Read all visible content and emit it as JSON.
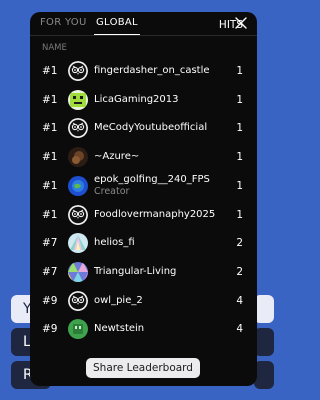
{
  "background_buttons": [
    {
      "label": "Y"
    },
    {
      "label": "L"
    },
    {
      "label": "R"
    }
  ],
  "tabs": {
    "for_you": "FOR YOU",
    "global": "GLOBAL",
    "active": "global"
  },
  "headers": {
    "name": "NAME",
    "hits": "HITS"
  },
  "rows": [
    {
      "rank": "#1",
      "name": "fingerdasher_on_castle",
      "sub": "",
      "hits": "1",
      "avatar": "owl-icon"
    },
    {
      "rank": "#1",
      "name": "LicaGaming2013",
      "sub": "",
      "hits": "1",
      "avatar": "green-face-icon"
    },
    {
      "rank": "#1",
      "name": "MeCodyYoutubeofficial",
      "sub": "",
      "hits": "1",
      "avatar": "owl-icon"
    },
    {
      "rank": "#1",
      "name": "~Azure~",
      "sub": "",
      "hits": "1",
      "avatar": "dark-photo-icon"
    },
    {
      "rank": "#1",
      "name": "epok_golfing__240_FPS",
      "sub": "Creator",
      "hits": "1",
      "avatar": "globe-photo-icon"
    },
    {
      "rank": "#1",
      "name": "Foodlovermanaphy2025",
      "sub": "",
      "hits": "1",
      "avatar": "owl-icon"
    },
    {
      "rank": "#7",
      "name": "helios_fi",
      "sub": "",
      "hits": "2",
      "avatar": "prism-icon"
    },
    {
      "rank": "#7",
      "name": "Triangular-Living",
      "sub": "",
      "hits": "2",
      "avatar": "triangle-pattern-icon"
    },
    {
      "rank": "#9",
      "name": "owl_pie_2",
      "sub": "",
      "hits": "4",
      "avatar": "owl-icon"
    },
    {
      "rank": "#9",
      "name": "Newtstein",
      "sub": "",
      "hits": "4",
      "avatar": "green-square-icon"
    }
  ],
  "share_button": "Share Leaderboard",
  "colors": {
    "page_bg": "#3a64c4",
    "panel_bg": "#0b0b0c",
    "muted_text": "#8a8a8a"
  }
}
